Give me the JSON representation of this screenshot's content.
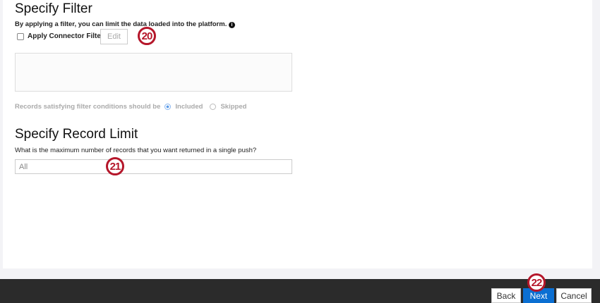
{
  "filter": {
    "title": "Specify Filter",
    "description": "By applying a filter, you can limit the data loaded into the platform.",
    "checkbox_label": "Apply Connector Filter",
    "edit_label": "Edit",
    "records_label": "Records satisfying filter conditions should be",
    "option_included": "Included",
    "option_skipped": "Skipped"
  },
  "limit": {
    "title": "Specify Record Limit",
    "question": "What is the maximum number of records that you want returned in a single push?",
    "value": "All"
  },
  "markers": [
    "20",
    "21",
    "22"
  ],
  "footer": {
    "back": "Back",
    "next": "Next",
    "cancel": "Cancel"
  }
}
